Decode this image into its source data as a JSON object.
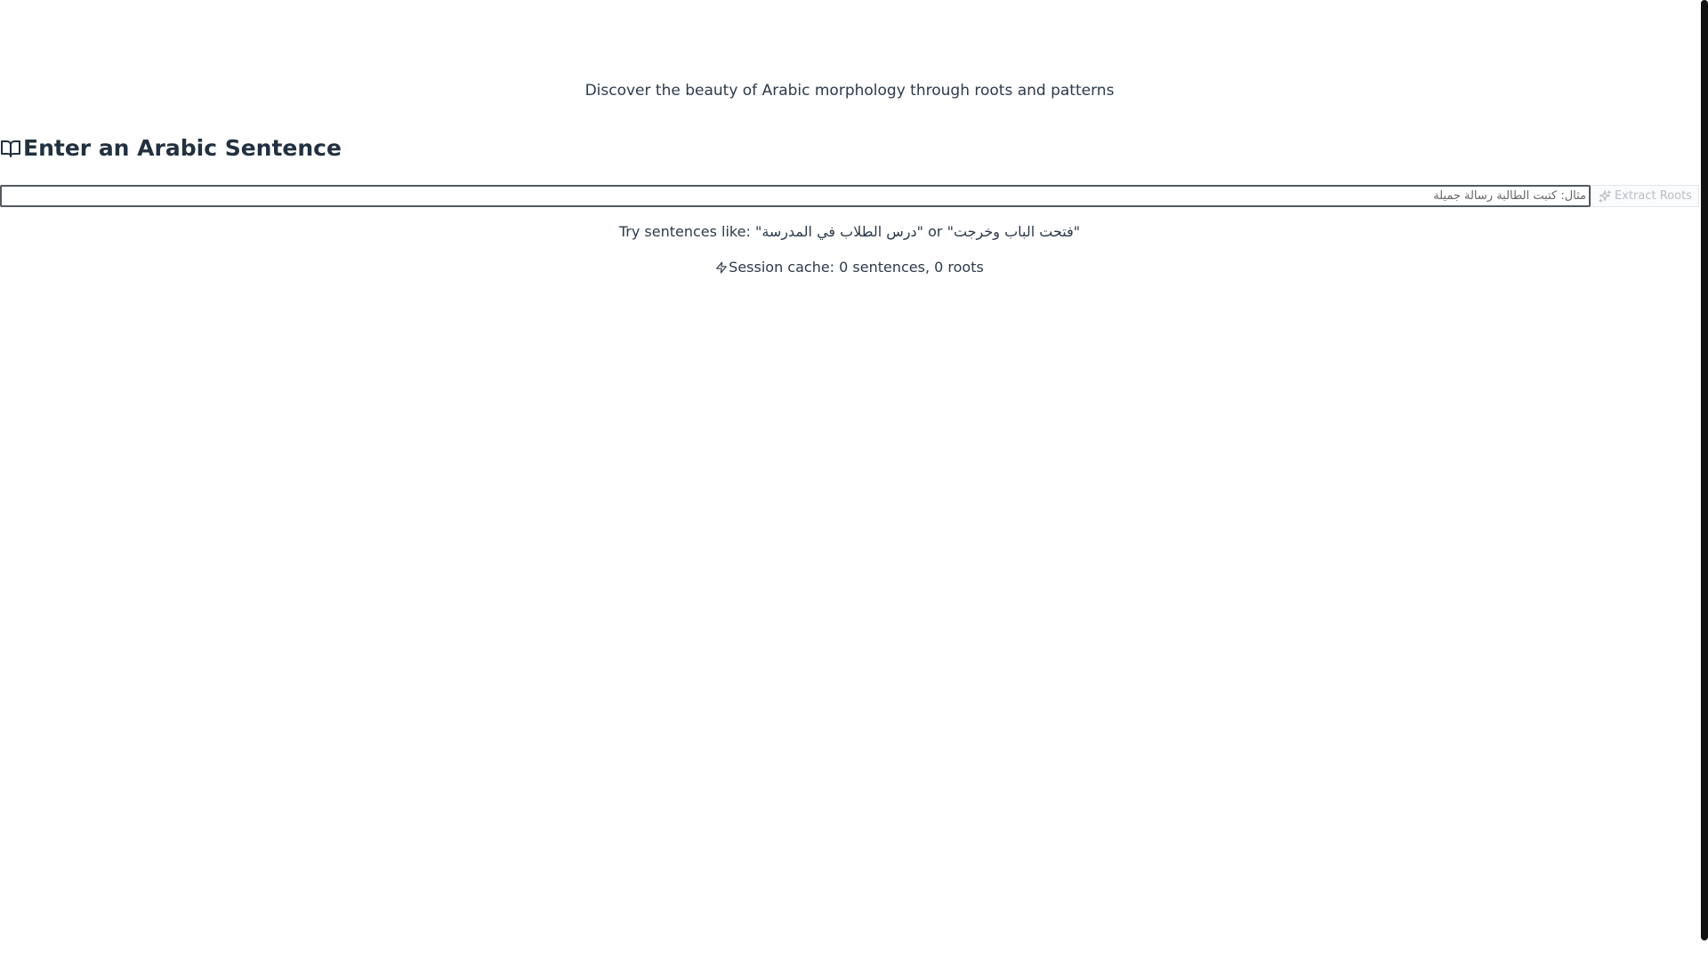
{
  "header": {
    "subtitle": "Discover the beauty of Arabic morphology through roots and patterns"
  },
  "input_section": {
    "heading": "Enter an Arabic Sentence",
    "heading_icon": "book-open-icon",
    "input_placeholder": "مثال: كتبت الطالبة رسالة جميلة",
    "input_value": "",
    "button_label": "Extract Roots",
    "button_icon": "sparkles-icon",
    "button_disabled": true
  },
  "examples": {
    "prefix": "Try sentences like: ",
    "example_1": "درس الطلاب في المدرسة",
    "connector": "or",
    "example_2": "فتحت الباب وخرجت"
  },
  "cache": {
    "icon": "zap-icon",
    "text": "Session cache: 0 sentences, 0 roots"
  },
  "colors": {
    "text": "#2d3a4a",
    "heading": "#22303f",
    "button_disabled_text": "#b9bfc6"
  }
}
